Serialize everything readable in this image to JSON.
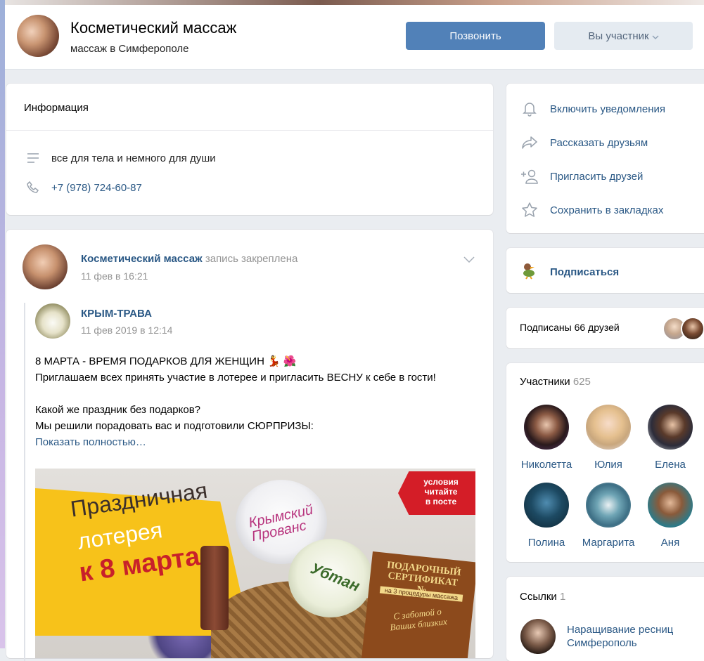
{
  "header": {
    "title": "Косметический массаж",
    "subtitle": "массаж в Симферополе",
    "call_button": "Позвонить",
    "member_button": "Вы участник"
  },
  "info": {
    "title": "Информация",
    "description": "все для тела и немного для души",
    "phone": "+7 (978) 724-60-87"
  },
  "post": {
    "author": "Косметический массаж",
    "pinned_label": "запись закреплена",
    "date": "11 фев в 16:21",
    "repost": {
      "author": "КРЫМ-ТРАВА",
      "date": "11 фев 2019 в 12:14"
    },
    "lines": [
      "8 МАРТА - ВРЕМЯ ПОДАРКОВ ДЛЯ ЖЕНЩИН 💃 🌺",
      "Приглашаем всех принять участие в лотерее и пригласить ВЕСНУ к себе в гости!",
      "Какой же праздник без подарков?",
      "Мы решили порадовать вас и подготовили СЮРПРИЗЫ:"
    ],
    "show_more": "Показать полностью…",
    "image": {
      "headline_1": "Праздничная",
      "headline_2": "лотерея",
      "headline_3": "к 8 марта",
      "badge": "условия\nчитайте\nв посте",
      "jar1_label": "Крымский\nПрованс",
      "jar2_label": "Убтан",
      "cert_title": "ПОДАРОЧНЫЙ\nСЕРТИФИКАТ\n№",
      "cert_sub": "на 3 процедуры массажа",
      "cert_note": "С заботой о\nВаших близких"
    }
  },
  "actions": [
    {
      "label": "Включить уведомления",
      "icon": "bell-icon"
    },
    {
      "label": "Рассказать друзьям",
      "icon": "share-icon"
    },
    {
      "label": "Пригласить друзей",
      "icon": "add-user-icon"
    },
    {
      "label": "Сохранить в закладках",
      "icon": "star-icon"
    }
  ],
  "subscribe": {
    "label": "Подписаться",
    "icon": "duck-icon"
  },
  "friends": {
    "label": "Подписаны 66 друзей"
  },
  "members": {
    "title": "Участники",
    "count": "625",
    "people": [
      {
        "name": "Николетта"
      },
      {
        "name": "Юлия"
      },
      {
        "name": "Елена"
      },
      {
        "name": "Полина"
      },
      {
        "name": "Маргарита"
      },
      {
        "name": "Аня"
      }
    ]
  },
  "links": {
    "title": "Ссылки",
    "count": "1",
    "item_line1": "Наращивание ресниц",
    "item_line2": "Симферополь"
  },
  "colors": {
    "accent": "#5181b8",
    "link": "#2a5885",
    "muted": "#939393",
    "page_bg": "#eaedf1"
  }
}
